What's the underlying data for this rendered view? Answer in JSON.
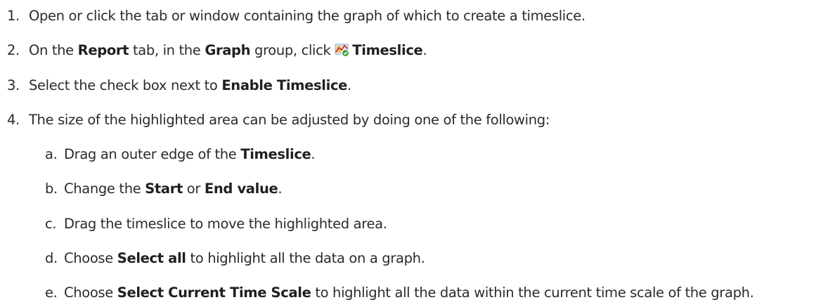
{
  "steps": [
    {
      "number": "1.",
      "parts": [
        "Open or click the tab or window containing the graph of which to create a timeslice."
      ]
    },
    {
      "number": "2.",
      "parts": [
        "On the ",
        "Report",
        " tab, in the ",
        "Graph",
        " group, click ",
        "Timeslice",
        "."
      ],
      "icon": "timeslice-graph-icon"
    },
    {
      "number": "3.",
      "parts": [
        "Select the check box next to ",
        "Enable Timeslice",
        "."
      ]
    },
    {
      "number": "4.",
      "parts": [
        "The size of the highlighted area can be adjusted by doing one of the following:"
      ]
    }
  ],
  "substeps": [
    {
      "letter": "a.",
      "parts": [
        "Drag an outer edge of the ",
        "Timeslice",
        "."
      ]
    },
    {
      "letter": "b.",
      "parts": [
        "Change the ",
        "Start",
        " or ",
        "End value",
        "."
      ]
    },
    {
      "letter": "c.",
      "parts": [
        "Drag the timeslice to move the highlighted area."
      ]
    },
    {
      "letter": "d.",
      "parts": [
        "Choose ",
        "Select all",
        " to highlight all the data on a graph."
      ]
    },
    {
      "letter": "e.",
      "parts": [
        "Choose ",
        "Select Current Time Scale",
        " to highlight all the data within the current time scale of the graph."
      ]
    }
  ]
}
